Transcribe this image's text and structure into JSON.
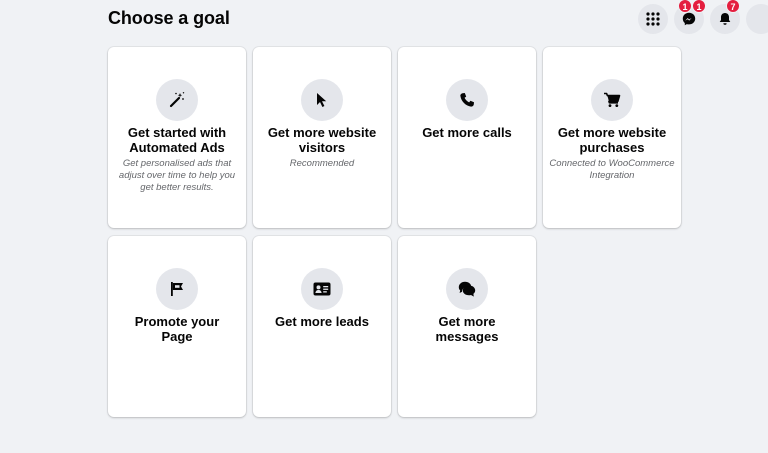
{
  "header": {
    "title": "Choose a goal"
  },
  "top_icons": [
    {
      "name": "apps-grid-icon",
      "badge": ""
    },
    {
      "name": "messenger-icon",
      "badge": "1"
    },
    {
      "name": "notifications-bell-icon",
      "badge": "7"
    }
  ],
  "badges": {
    "messenger": "1",
    "messenger_extra": "1",
    "notifications": "7"
  },
  "goals": [
    {
      "title": "Get started with Automated Ads",
      "description": "Get personalised ads that adjust over time to help you get better results.",
      "icon": "magic-wand-icon"
    },
    {
      "title": "Get more website visitors",
      "description": "Recommended",
      "icon": "cursor-pointer-icon"
    },
    {
      "title": "Get more calls",
      "description": "",
      "icon": "phone-icon"
    },
    {
      "title": "Get more website purchases",
      "description": "Connected to WooCommerce Integration",
      "icon": "shopping-cart-icon"
    },
    {
      "title": "Promote your Page",
      "description": "",
      "icon": "flag-icon"
    },
    {
      "title": "Get more leads",
      "description": "",
      "icon": "contact-card-icon"
    },
    {
      "title": "Get more messages",
      "description": "",
      "icon": "chat-bubbles-icon"
    }
  ],
  "colors": {
    "background": "#f0f2f5",
    "card": "#ffffff",
    "icon_circle": "#e4e6eb",
    "badge": "#e41e3f",
    "secondary_text": "#65676b"
  }
}
